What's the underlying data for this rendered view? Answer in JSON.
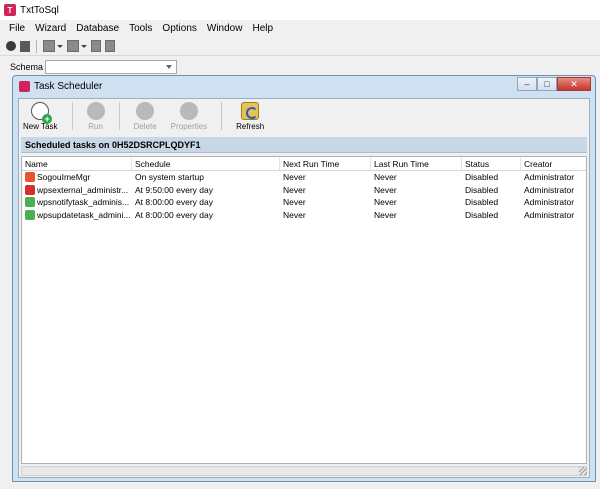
{
  "app": {
    "title": "TxtToSql",
    "icon": "app-logo-icon"
  },
  "menu": [
    "File",
    "Wizard",
    "Database",
    "Tools",
    "Options",
    "Window",
    "Help"
  ],
  "schema": {
    "label": "Schema",
    "value": ""
  },
  "window": {
    "title": "Task Scheduler",
    "minimize": "–",
    "restore": "□",
    "close": "✕"
  },
  "toolbar": {
    "new_task": "New Task",
    "run": "Run",
    "delete": "Delete",
    "properties": "Properties",
    "refresh": "Refresh"
  },
  "header": "Scheduled tasks on 0H52DSRCPLQDYF1",
  "columns": [
    "Name",
    "Schedule",
    "Next Run Time",
    "Last Run Time",
    "Status",
    "Creator"
  ],
  "rows": [
    {
      "name": "SogouImeMgr",
      "schedule": "On system startup",
      "next": "Never",
      "last": "Never",
      "status": "Disabled",
      "creator": "Administrator",
      "icon_color": "#e8552c"
    },
    {
      "name": "wpsexternal_administr...",
      "schedule": "At 9:50:00 every day",
      "next": "Never",
      "last": "Never",
      "status": "Disabled",
      "creator": "Administrator",
      "icon_color": "#d62e2e"
    },
    {
      "name": "wpsnotifytask_adminis...",
      "schedule": "At 8:00:00 every day",
      "next": "Never",
      "last": "Never",
      "status": "Disabled",
      "creator": "Administrator",
      "icon_color": "#4caf50"
    },
    {
      "name": "wpsupdatetask_admini...",
      "schedule": "At 8:00:00 every day",
      "next": "Never",
      "last": "Never",
      "status": "Disabled",
      "creator": "Administrator",
      "icon_color": "#4caf50"
    }
  ]
}
